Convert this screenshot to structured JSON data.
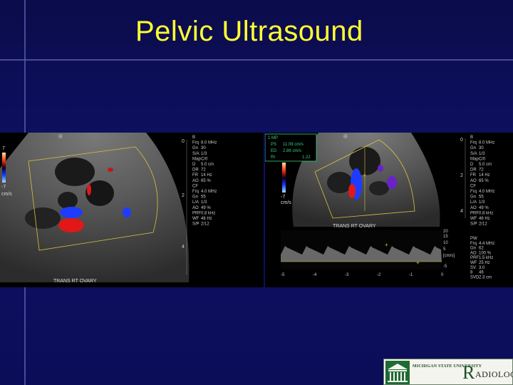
{
  "slide": {
    "title": "Pelvic Ultrasound"
  },
  "left_image": {
    "orientation_marker": "®",
    "caption": "TRANS RT OVARY",
    "scale_top": "7",
    "scale_bottom": "-7",
    "scale_unit": "cm/s",
    "depth_marks": [
      "0",
      "2",
      "4"
    ],
    "param_labels": [
      "B",
      "Frq",
      "Gn",
      "S/A",
      "Map",
      "D",
      "DR",
      "FR",
      "AO",
      "CF",
      "Frq",
      "Gn",
      "L/A",
      "AO",
      "PRF",
      "WF",
      "S/P"
    ],
    "param_values": [
      "",
      "8.0 MHz",
      "30",
      "1/3",
      "C/0",
      "5.0 cm",
      "72",
      "14 Hz",
      "65 %",
      "",
      "4.0 MHz",
      "55",
      "1/3",
      "49 %",
      "0.8 kHz",
      "46 Hz",
      "2/12"
    ]
  },
  "right_image": {
    "orientation_marker": "®",
    "caption": "TRANS RT OVARY",
    "meas_header": "1 MP",
    "measurements": [
      {
        "label": "PS",
        "value": "11.09 cm/s"
      },
      {
        "label": "ED",
        "value": "2.86 cm/s"
      },
      {
        "label": "RI",
        "value": "1.22"
      }
    ],
    "scale_top": "7",
    "scale_bottom": "-7",
    "scale_unit": "cm/s",
    "depth_marks": [
      "0",
      "2",
      "4"
    ],
    "param_labels": [
      "B",
      "Frq",
      "Gn",
      "S/A",
      "Map",
      "D",
      "DR",
      "FR",
      "AO",
      "CF",
      "Frq",
      "Gn",
      "L/A",
      "AO",
      "PRF",
      "WF",
      "S/P"
    ],
    "param_values": [
      "",
      "8.0 MHz",
      "30",
      "1/3",
      "C/0",
      "5.0 cm",
      "72",
      "14 Hz",
      "65 %",
      "",
      "4.0 MHz",
      "55",
      "1/3",
      "49 %",
      "0.8 kHz",
      "46 Hz",
      "2/12"
    ],
    "pw_labels": [
      "PW",
      "Frq",
      "Gn",
      "AO",
      "PRF",
      "WF",
      "SV",
      "8",
      "SVD"
    ],
    "pw_values": [
      "",
      "4.4 MHz",
      "62",
      "100 %",
      "1.5 kHz",
      "25 Hz",
      "3.0",
      "46",
      "2.3 cm"
    ],
    "spectral_scale": [
      "20",
      "15",
      "10",
      "5",
      "[cm/s]",
      "-5"
    ],
    "spectral_time": [
      "-5",
      "-4",
      "-3",
      "-2",
      "-1",
      "0"
    ]
  },
  "logo": {
    "university": "MICHIGAN STATE UNIVERSITY",
    "department_initial": "R",
    "department_rest": "ADIOLOGY"
  },
  "colors": {
    "background": "#0e1066",
    "title": "#ffff33",
    "doppler_red": "#e01818",
    "doppler_blue": "#1e3cff",
    "annotation_yellow": "#d9c23a",
    "measure_green": "#39d17a"
  }
}
